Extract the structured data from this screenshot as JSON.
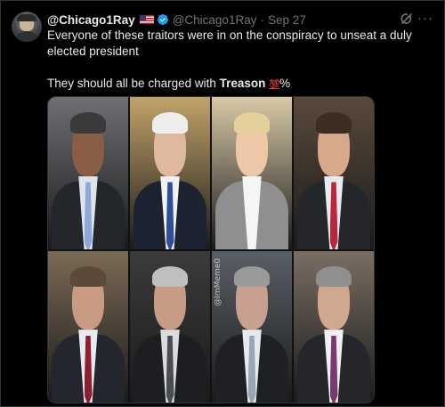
{
  "tweet": {
    "display_name": "@Chicago1Ray",
    "handle": "@Chicago1Ray",
    "separator": "·",
    "time": "Sep 27",
    "text_line1": "Everyone of these traitors were in on the conspiracy to unseat a duly elected president",
    "text_line2_prefix": "They should all be charged with ",
    "text_line2_bold": "Treason",
    "text_line2_emoji": "💯",
    "text_line2_suffix": "%",
    "more_symbol": "···"
  },
  "icons": {
    "flag": "us-flag-icon",
    "verified": "verified-badge-icon",
    "grok": "grok-icon",
    "more": "more-options-icon"
  },
  "colors": {
    "background": "#000000",
    "text": "#e7e9ea",
    "muted": "#71767b",
    "verified": "#1d9bf0",
    "hundred": "#e0245e"
  },
  "media": {
    "watermark": "@ImMeme0",
    "portraits": [
      {
        "bg": "#6d6f73",
        "face": "#8a5e44",
        "hair": "#3a3a3a",
        "suit": "#23262b",
        "shirt": "#dfe3ea",
        "tie": "#8fa8d8"
      },
      {
        "bg": "#c2a36a",
        "face": "#e0b8a0",
        "hair": "#eeeeee",
        "suit": "#1c2230",
        "shirt": "#f2f2f2",
        "tie": "#2f4f9a"
      },
      {
        "bg": "#d9c9a8",
        "face": "#ecc7a8",
        "hair": "#e3d09a",
        "suit": "#8f8f8f",
        "shirt": "#f5f5f5",
        "tie": "#f5f5f5"
      },
      {
        "bg": "#5a4a3c",
        "face": "#d8a88a",
        "hair": "#3b2d22",
        "suit": "#24262c",
        "shirt": "#e8ecf2",
        "tie": "#b8283a"
      },
      {
        "bg": "#7b6a56",
        "face": "#c89b82",
        "hair": "#5b4a3a",
        "suit": "#23262c",
        "shirt": "#e8ecf2",
        "tie": "#8e1e30"
      },
      {
        "bg": "#3b3b3b",
        "face": "#c89c84",
        "hair": "#bfbfbf",
        "suit": "#1d1e22",
        "shirt": "#dcdcdc",
        "tie": "#4a4d55"
      },
      {
        "bg": "#5a5f66",
        "face": "#c8a090",
        "hair": "#9a9a9a",
        "suit": "#1e2024",
        "shirt": "#e6e9ee",
        "tie": "#9aa6b8"
      },
      {
        "bg": "#7a6e62",
        "face": "#d0a890",
        "hair": "#8f8f8f",
        "suit": "#24262c",
        "shirt": "#eef0f4",
        "tie": "#7a3a6e"
      }
    ]
  }
}
